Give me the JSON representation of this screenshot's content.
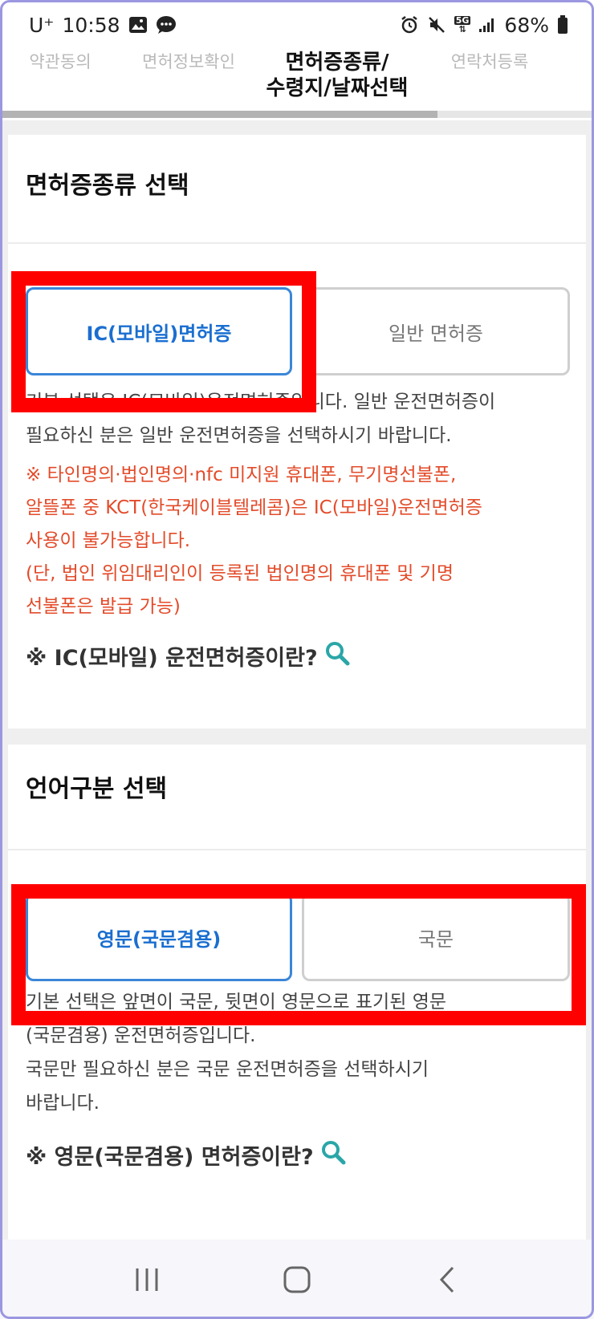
{
  "status_bar": {
    "carrier": "U⁺",
    "time": "10:58",
    "battery": "68%",
    "network": "5G"
  },
  "tabs": [
    {
      "label": "약관동의"
    },
    {
      "label": "면허정보확인"
    },
    {
      "label_line1": "면허증종류/",
      "label_line2": "수령지/날짜선택"
    },
    {
      "label": "연락처등록"
    }
  ],
  "license_section": {
    "title": "면허증종류 선택",
    "option_selected": "IC(모바일)면허증",
    "option_other": "일반 면허증",
    "desc_line1": "기본 선택은 IC(모바일)운전면허증입니다. 일반 운전면허증이",
    "desc_line2": "필요하신 분은 일반 운전면허증을 선택하시기 바랍니다.",
    "warn_line1": "※ 타인명의·법인명의·nfc 미지원 휴대폰, 무기명선불폰,",
    "warn_line2": "알뜰폰 중 KCT(한국케이블텔레콤)은 IC(모바일)운전면허증",
    "warn_line3": "사용이 불가능합니다.",
    "warn_line4": "(단, 법인 위임대리인이 등록된 법인명의 휴대폰 및 기명",
    "warn_line5": "선불폰은 발급 가능)",
    "info_link": "※ IC(모바일) 운전면허증이란?"
  },
  "language_section": {
    "title": "언어구분 선택",
    "option_selected": "영문(국문겸용)",
    "option_other": "국문",
    "desc_line1": "기본 선택은 앞면이 국문, 뒷면이 영문으로 표기된 영문",
    "desc_line2": "(국문겸용) 운전면허증입니다.",
    "desc_line3": "국문만 필요하신 분은 국문 운전면허증을 선택하시기",
    "desc_line4": "바랍니다.",
    "info_link": "※ 영문(국문겸용) 면허증이란?"
  },
  "colors": {
    "accent": "#1a6ed0",
    "warning": "#e34b2a",
    "highlight": "#ff0000",
    "search_icon": "#2aa6a8"
  }
}
